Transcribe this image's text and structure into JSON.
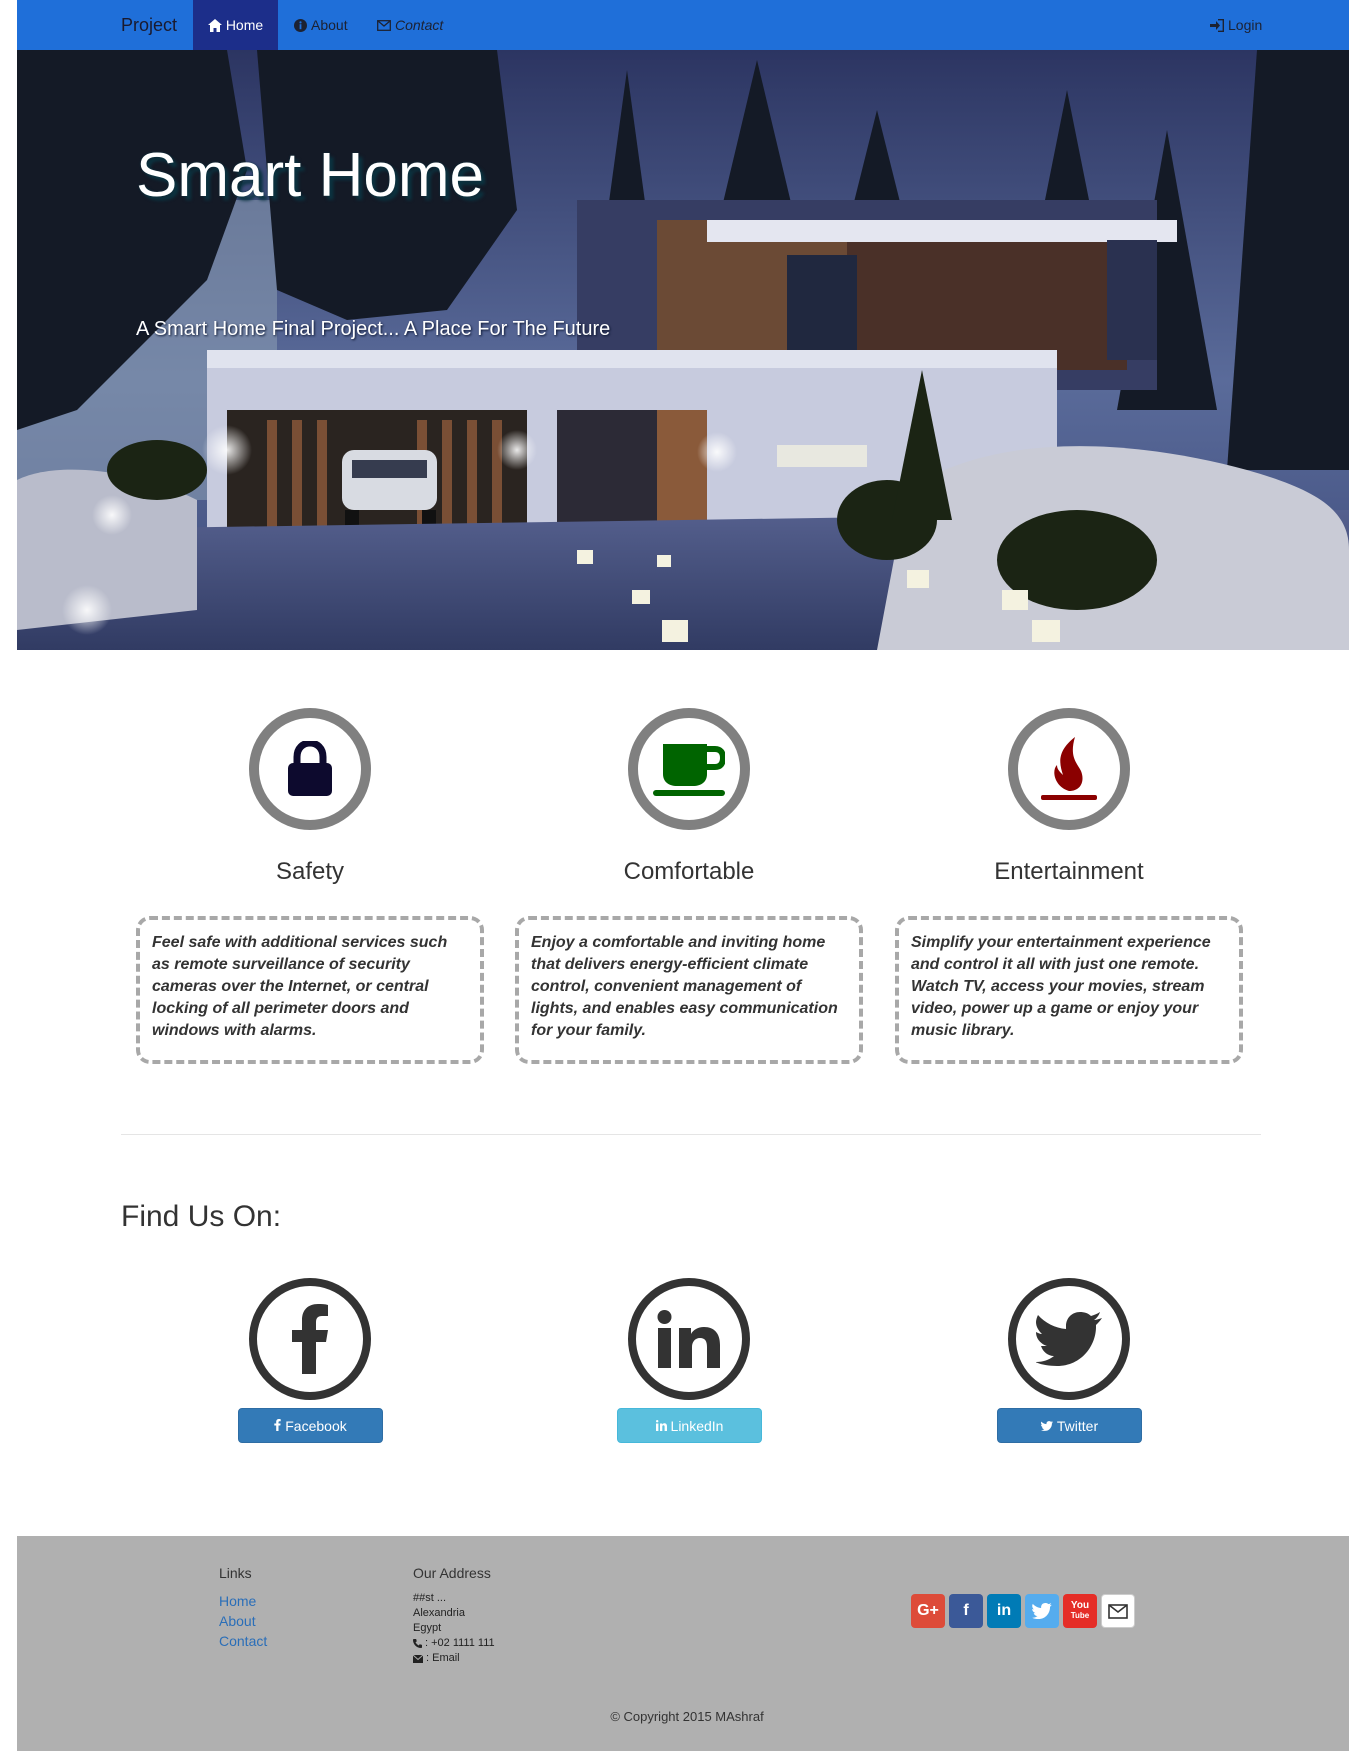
{
  "navbar": {
    "brand": "Project",
    "home_label": "Home",
    "about_label": "About",
    "contact_label": "Contact",
    "login_label": "Login"
  },
  "hero": {
    "title": "Smart Home",
    "subtitle": "A Smart Home Final Project... A Place For The Future"
  },
  "features": [
    {
      "title": "Safety",
      "icon": "lock-icon",
      "icon_color": "#0d0a2e",
      "text": "Feel safe with additional services such as remote surveillance of security cameras over the Internet, or central locking of all perimeter doors and windows with alarms."
    },
    {
      "title": "Comfortable",
      "icon": "coffee-cup-icon",
      "icon_color": "#006400",
      "text": "Enjoy a comfortable and inviting home that delivers energy-efficient climate control, convenient management of lights, and enables easy communication for your family."
    },
    {
      "title": "Entertainment",
      "icon": "fire-icon",
      "icon_color": "#8b0000",
      "text": "Simplify your entertainment experience and control it all with just one remote. Watch TV, access your movies, stream video, power up a game or enjoy your music library."
    }
  ],
  "find_us": {
    "heading": "Find Us On:",
    "items": [
      {
        "label": "Facebook",
        "icon": "facebook-icon"
      },
      {
        "label": "LinkedIn",
        "icon": "linkedin-icon"
      },
      {
        "label": "Twitter",
        "icon": "twitter-icon"
      }
    ]
  },
  "footer": {
    "links_heading": "Links",
    "links": [
      "Home",
      "About",
      "Contact"
    ],
    "address_heading": "Our Address",
    "address_lines": [
      "##st ...",
      "Alexandria",
      "Egypt"
    ],
    "phone": ": +02 1111 111",
    "email": ": Email",
    "social_icons": [
      {
        "name": "google-plus-icon",
        "glyph": "G+",
        "color": "#dd4b39"
      },
      {
        "name": "facebook-icon",
        "glyph": "f",
        "color": "#3b5998"
      },
      {
        "name": "linkedin-icon",
        "glyph": "in",
        "color": "#007bb6"
      },
      {
        "name": "twitter-icon",
        "glyph": "t",
        "color": "#55acee"
      },
      {
        "name": "youtube-icon",
        "glyph": "You",
        "color": "#e52d27"
      },
      {
        "name": "envelope-icon",
        "glyph": "✉",
        "color": "#ffffff"
      }
    ],
    "copyright": "© Copyright 2015 MAshraf"
  }
}
